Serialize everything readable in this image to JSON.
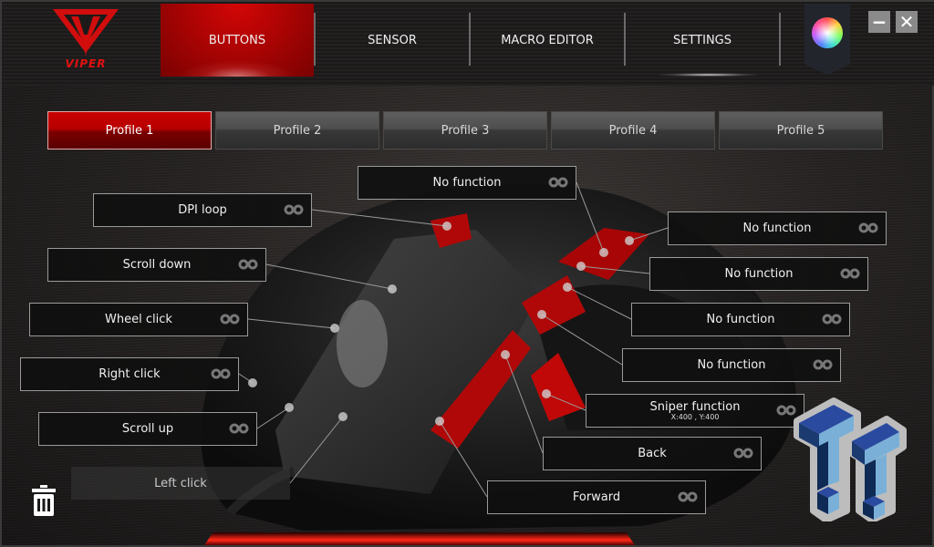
{
  "app": {
    "brand": "VIPER",
    "accent_color": "#c00000"
  },
  "nav": {
    "tabs": [
      {
        "label": "BUTTONS",
        "active": true
      },
      {
        "label": "SENSOR",
        "active": false
      },
      {
        "label": "MACRO EDITOR",
        "active": false
      },
      {
        "label": "SETTINGS",
        "active": false
      }
    ],
    "color_picker_icon": "color-wheel-icon"
  },
  "window": {
    "minimize_label": "−",
    "close_label": "✕"
  },
  "profiles": [
    {
      "label": "Profile 1",
      "active": true
    },
    {
      "label": "Profile 2",
      "active": false
    },
    {
      "label": "Profile 3",
      "active": false
    },
    {
      "label": "Profile 4",
      "active": false
    },
    {
      "label": "Profile 5",
      "active": false
    }
  ],
  "buttons": {
    "top": {
      "label": "No function"
    },
    "dpi": {
      "label": "DPI loop"
    },
    "scroll_down": {
      "label": "Scroll down"
    },
    "wheel_click": {
      "label": "Wheel click"
    },
    "right_click": {
      "label": "Right click"
    },
    "scroll_up": {
      "label": "Scroll up"
    },
    "left_click": {
      "label": "Left click"
    },
    "side1": {
      "label": "No function"
    },
    "side2": {
      "label": "No function"
    },
    "side3": {
      "label": "No function"
    },
    "side4": {
      "label": "No function"
    },
    "sniper": {
      "label": "Sniper function",
      "sub": "X:400 , Y:400"
    },
    "back": {
      "label": "Back"
    },
    "forward": {
      "label": "Forward"
    }
  },
  "icons": {
    "link": "link-icon",
    "trash": "trash-icon",
    "watermark": "tt-logo"
  }
}
